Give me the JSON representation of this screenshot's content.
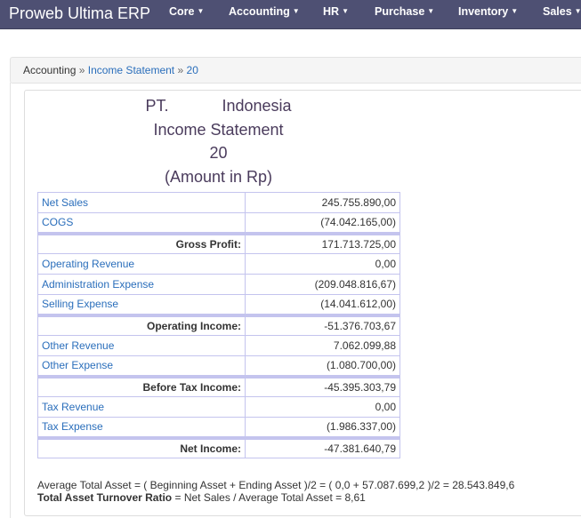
{
  "navbar": {
    "brand": "Proweb Ultima ERP",
    "menus": [
      "Core",
      "Accounting",
      "HR",
      "Purchase",
      "Inventory",
      "Sales"
    ]
  },
  "breadcrumb": {
    "root": "Accounting",
    "sep": "»",
    "page": "Income Statement",
    "period": "20"
  },
  "report": {
    "company": "PT.            Indonesia",
    "title": "Income Statement",
    "period": "20",
    "unit": "(Amount in Rp)"
  },
  "rows": [
    {
      "label": "Net Sales",
      "value": "245.755.890,00",
      "type": "item"
    },
    {
      "label": "COGS",
      "value": "(74.042.165,00)",
      "type": "item"
    },
    {
      "label": "Gross Profit:",
      "value": "171.713.725,00",
      "type": "sum"
    },
    {
      "label": "Operating Revenue",
      "value": "0,00",
      "type": "item"
    },
    {
      "label": "Administration Expense",
      "value": "(209.048.816,67)",
      "type": "item"
    },
    {
      "label": "Selling Expense",
      "value": "(14.041.612,00)",
      "type": "item"
    },
    {
      "label": "Operating Income:",
      "value": "-51.376.703,67",
      "type": "sum"
    },
    {
      "label": "Other Revenue",
      "value": "7.062.099,88",
      "type": "item"
    },
    {
      "label": "Other Expense",
      "value": "(1.080.700,00)",
      "type": "item"
    },
    {
      "label": "Before Tax Income:",
      "value": "-45.395.303,79",
      "type": "sum"
    },
    {
      "label": "Tax Revenue",
      "value": "0,00",
      "type": "item"
    },
    {
      "label": "Tax Expense",
      "value": "(1.986.337,00)",
      "type": "item"
    },
    {
      "label": "Net Income:",
      "value": "-47.381.640,79",
      "type": "sum"
    }
  ],
  "footer": {
    "avg_asset": "Average Total Asset = ( Beginning Asset + Ending Asset )/2 = ( 0,0 + 57.087.699,2 )/2 = 28.543.849,6",
    "ratio_label": "Total Asset Turnover Ratio",
    "ratio_rest": " = Net Sales / Average Total Asset = 8,61"
  }
}
